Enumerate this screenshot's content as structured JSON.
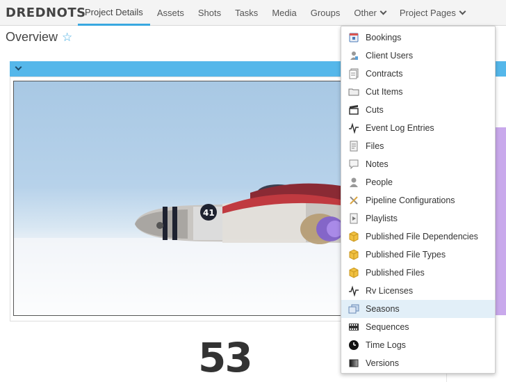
{
  "brand": "DREDNOTS",
  "nav": [
    {
      "label": "Project Details",
      "name": "nav-project-details",
      "active": true
    },
    {
      "label": "Assets",
      "name": "nav-assets"
    },
    {
      "label": "Shots",
      "name": "nav-shots"
    },
    {
      "label": "Tasks",
      "name": "nav-tasks"
    },
    {
      "label": "Media",
      "name": "nav-media"
    },
    {
      "label": "Groups",
      "name": "nav-groups"
    },
    {
      "label": "Other",
      "name": "nav-other",
      "dropdown": true
    },
    {
      "label": "Project Pages",
      "name": "nav-project-pages",
      "dropdown": true
    }
  ],
  "page": {
    "title": "Overview",
    "favorite_icon": "star-outline-icon"
  },
  "widget": {
    "count": "53"
  },
  "dropdown": {
    "items": [
      {
        "label": "Bookings",
        "icon": "bookings-icon"
      },
      {
        "label": "Client Users",
        "icon": "client-users-icon"
      },
      {
        "label": "Contracts",
        "icon": "contracts-icon"
      },
      {
        "label": "Cut Items",
        "icon": "folder-icon"
      },
      {
        "label": "Cuts",
        "icon": "clapper-icon"
      },
      {
        "label": "Event Log Entries",
        "icon": "pulse-icon"
      },
      {
        "label": "Files",
        "icon": "file-icon"
      },
      {
        "label": "Notes",
        "icon": "note-icon"
      },
      {
        "label": "People",
        "icon": "person-icon"
      },
      {
        "label": "Pipeline Configurations",
        "icon": "tools-icon"
      },
      {
        "label": "Playlists",
        "icon": "playlist-icon"
      },
      {
        "label": "Published File Dependencies",
        "icon": "package-icon"
      },
      {
        "label": "Published File Types",
        "icon": "package-icon"
      },
      {
        "label": "Published Files",
        "icon": "package-icon"
      },
      {
        "label": "Rv Licenses",
        "icon": "pulse-icon"
      },
      {
        "label": "Seasons",
        "icon": "seasons-icon",
        "highlighted": true
      },
      {
        "label": "Sequences",
        "icon": "filmstrip-icon"
      },
      {
        "label": "Time Logs",
        "icon": "clock-icon"
      },
      {
        "label": "Versions",
        "icon": "versions-icon"
      }
    ]
  },
  "colors": {
    "accent": "#39a8e0",
    "widget_header": "#55b7ea",
    "highlight": "#e2eff8",
    "side_card": "#c9a9ec"
  }
}
